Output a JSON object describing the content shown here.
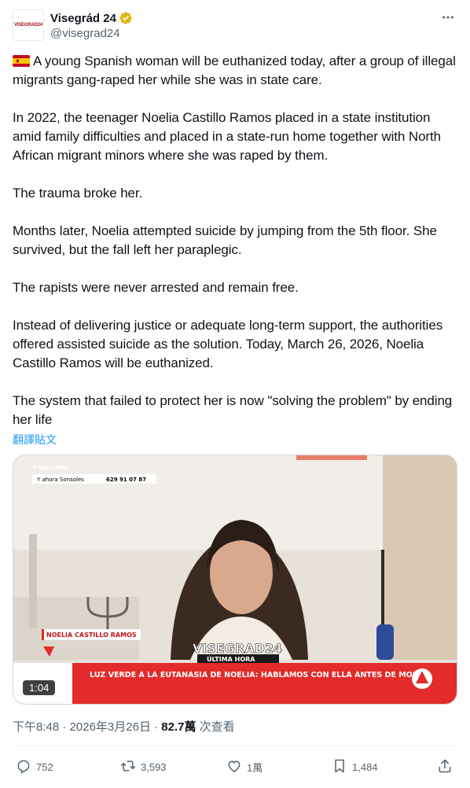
{
  "author": {
    "display_name": "Visegrád 24",
    "handle": "@visegrad24",
    "avatar_text": "VISEGRAD24"
  },
  "tweet": {
    "paragraphs": [
      "A young Spanish woman will be euthanized today, after a group of illegal migrants gang-raped her while she was in state care.",
      "In 2022, the teenager Noelia Castillo Ramos placed in a state institution amid family difficulties and placed in a state-run home together with North African migrant minors where she was raped by them.",
      "The trauma broke her.",
      "Months later, Noelia attempted suicide by jumping from the 5th floor. She survived, but the fall left her paraplegic.",
      "The rapists were never arrested and remain free.",
      "Instead of delivering justice or adequate long-term support, the authorities offered assisted suicide as the solution. Today, March 26, 2026, Noelia Castillo Ramos will be euthanized.",
      "The system that failed to protect her is now \"solving the problem\" by ending her life"
    ],
    "translate_label": "翻譯貼文"
  },
  "video": {
    "hashtag": "#YAS24Mar",
    "phone_label": "Y ahora Sonsoles",
    "phone_number": "629 91 07 87",
    "name_tag": "NOELIA CASTILLO RAMOS",
    "watermark": "VISEGRAD24",
    "breaking": "ÚLTIMA HORA",
    "ticker": "LUZ VERDE A LA EUTANASIA DE NOELIA: HABLAMOS CON ELLA ANTES DE MORIR",
    "duration": "1:04"
  },
  "meta": {
    "time": "下午8:48",
    "date": "2026年3月26日",
    "views": "82.7萬",
    "views_label": "次查看"
  },
  "actions": {
    "replies": "752",
    "reposts": "3,593",
    "likes": "1萬",
    "bookmarks": "1,484"
  },
  "colors": {
    "accent": "#1d9bf0",
    "ticker_bg": "#e32b2b",
    "verified": "#e2b719"
  }
}
